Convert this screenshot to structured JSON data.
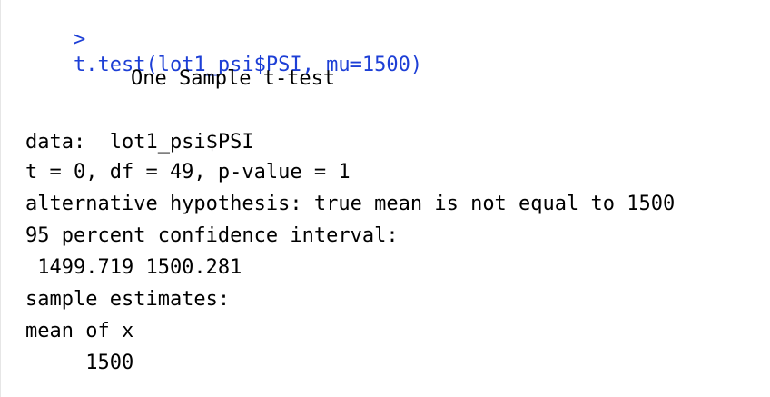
{
  "console": {
    "prompt": ">",
    "command": "t.test(lot1_psi$PSI, mu=1500)",
    "output": {
      "title": "One Sample t-test",
      "data_line": "data:  lot1_psi$PSI",
      "stats_line": "t = 0, df = 49, p-value = 1",
      "alternative_line": "alternative hypothesis: true mean is not equal to 1500",
      "ci_label": "95 percent confidence interval:",
      "ci_values": " 1499.719 1500.281",
      "estimates_label": "sample estimates:",
      "estimate_name": "mean of x",
      "estimate_value": "     1500"
    }
  },
  "colors": {
    "command": "#1d3fd6",
    "output": "#000000"
  }
}
